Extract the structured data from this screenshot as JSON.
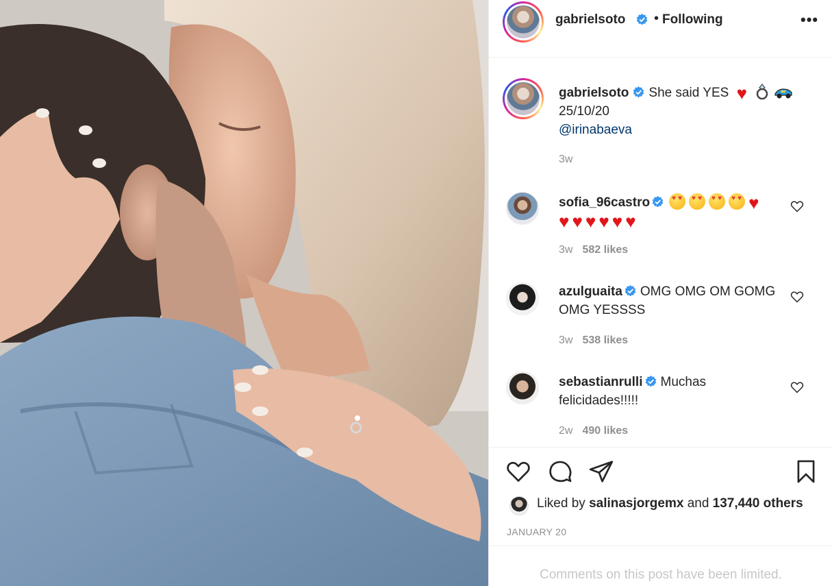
{
  "post": {
    "image_icon": "couple-kissing-photo",
    "author": {
      "username": "gabrielsoto",
      "verified_icon": "verified-badge-icon",
      "follow_status": "Following",
      "more_icon": "more-options-icon"
    },
    "caption": {
      "username": "gabrielsoto",
      "text": "She said YES",
      "emojis": [
        "red-heart",
        "ring",
        "racing-car"
      ],
      "date_line": "25/10/20",
      "mention": "@irinabaeva",
      "time": "3w"
    },
    "comments": [
      {
        "username": "sofia_96castro",
        "verified": true,
        "text": "",
        "emoji_line1": [
          "heart-eyes",
          "heart-eyes",
          "heart-eyes",
          "heart-eyes",
          "red-heart"
        ],
        "emoji_line2": [
          "red-heart",
          "red-heart",
          "red-heart",
          "red-heart",
          "red-heart",
          "red-heart"
        ],
        "time": "3w",
        "likes": "582 likes"
      },
      {
        "username": "azulguaita",
        "verified": true,
        "text": "OMG OMG OM GOMG OMG YESSSS",
        "time": "3w",
        "likes": "538 likes"
      },
      {
        "username": "sebastianrulli",
        "verified": true,
        "text": "Muchas felicidades!!!!!",
        "time": "2w",
        "likes": "490 likes"
      }
    ],
    "actions": {
      "like_icon": "heart-outline-icon",
      "comment_icon": "comment-bubble-icon",
      "share_icon": "paper-plane-icon",
      "save_icon": "bookmark-icon"
    },
    "liked_by": {
      "prefix": "Liked by",
      "username": "salinasjorgemx",
      "joiner": "and",
      "count": "137,440 others"
    },
    "date": "JANUARY 20",
    "comments_limited": "Comments on this post have been limited."
  },
  "colors": {
    "verified": "#3897f0",
    "link": "#00376b",
    "muted": "#8e8e8e",
    "heart": "#e0161b"
  }
}
